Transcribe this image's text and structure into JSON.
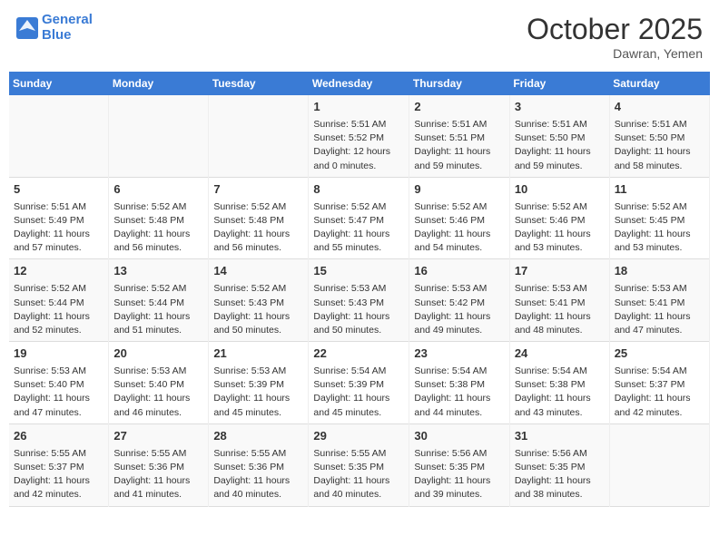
{
  "header": {
    "logo_line1": "General",
    "logo_line2": "Blue",
    "month": "October 2025",
    "location": "Dawran, Yemen"
  },
  "weekdays": [
    "Sunday",
    "Monday",
    "Tuesday",
    "Wednesday",
    "Thursday",
    "Friday",
    "Saturday"
  ],
  "weeks": [
    [
      {
        "day": "",
        "sunrise": "",
        "sunset": "",
        "daylight": ""
      },
      {
        "day": "",
        "sunrise": "",
        "sunset": "",
        "daylight": ""
      },
      {
        "day": "",
        "sunrise": "",
        "sunset": "",
        "daylight": ""
      },
      {
        "day": "1",
        "sunrise": "Sunrise: 5:51 AM",
        "sunset": "Sunset: 5:52 PM",
        "daylight": "Daylight: 12 hours and 0 minutes."
      },
      {
        "day": "2",
        "sunrise": "Sunrise: 5:51 AM",
        "sunset": "Sunset: 5:51 PM",
        "daylight": "Daylight: 11 hours and 59 minutes."
      },
      {
        "day": "3",
        "sunrise": "Sunrise: 5:51 AM",
        "sunset": "Sunset: 5:50 PM",
        "daylight": "Daylight: 11 hours and 59 minutes."
      },
      {
        "day": "4",
        "sunrise": "Sunrise: 5:51 AM",
        "sunset": "Sunset: 5:50 PM",
        "daylight": "Daylight: 11 hours and 58 minutes."
      }
    ],
    [
      {
        "day": "5",
        "sunrise": "Sunrise: 5:51 AM",
        "sunset": "Sunset: 5:49 PM",
        "daylight": "Daylight: 11 hours and 57 minutes."
      },
      {
        "day": "6",
        "sunrise": "Sunrise: 5:52 AM",
        "sunset": "Sunset: 5:48 PM",
        "daylight": "Daylight: 11 hours and 56 minutes."
      },
      {
        "day": "7",
        "sunrise": "Sunrise: 5:52 AM",
        "sunset": "Sunset: 5:48 PM",
        "daylight": "Daylight: 11 hours and 56 minutes."
      },
      {
        "day": "8",
        "sunrise": "Sunrise: 5:52 AM",
        "sunset": "Sunset: 5:47 PM",
        "daylight": "Daylight: 11 hours and 55 minutes."
      },
      {
        "day": "9",
        "sunrise": "Sunrise: 5:52 AM",
        "sunset": "Sunset: 5:46 PM",
        "daylight": "Daylight: 11 hours and 54 minutes."
      },
      {
        "day": "10",
        "sunrise": "Sunrise: 5:52 AM",
        "sunset": "Sunset: 5:46 PM",
        "daylight": "Daylight: 11 hours and 53 minutes."
      },
      {
        "day": "11",
        "sunrise": "Sunrise: 5:52 AM",
        "sunset": "Sunset: 5:45 PM",
        "daylight": "Daylight: 11 hours and 53 minutes."
      }
    ],
    [
      {
        "day": "12",
        "sunrise": "Sunrise: 5:52 AM",
        "sunset": "Sunset: 5:44 PM",
        "daylight": "Daylight: 11 hours and 52 minutes."
      },
      {
        "day": "13",
        "sunrise": "Sunrise: 5:52 AM",
        "sunset": "Sunset: 5:44 PM",
        "daylight": "Daylight: 11 hours and 51 minutes."
      },
      {
        "day": "14",
        "sunrise": "Sunrise: 5:52 AM",
        "sunset": "Sunset: 5:43 PM",
        "daylight": "Daylight: 11 hours and 50 minutes."
      },
      {
        "day": "15",
        "sunrise": "Sunrise: 5:53 AM",
        "sunset": "Sunset: 5:43 PM",
        "daylight": "Daylight: 11 hours and 50 minutes."
      },
      {
        "day": "16",
        "sunrise": "Sunrise: 5:53 AM",
        "sunset": "Sunset: 5:42 PM",
        "daylight": "Daylight: 11 hours and 49 minutes."
      },
      {
        "day": "17",
        "sunrise": "Sunrise: 5:53 AM",
        "sunset": "Sunset: 5:41 PM",
        "daylight": "Daylight: 11 hours and 48 minutes."
      },
      {
        "day": "18",
        "sunrise": "Sunrise: 5:53 AM",
        "sunset": "Sunset: 5:41 PM",
        "daylight": "Daylight: 11 hours and 47 minutes."
      }
    ],
    [
      {
        "day": "19",
        "sunrise": "Sunrise: 5:53 AM",
        "sunset": "Sunset: 5:40 PM",
        "daylight": "Daylight: 11 hours and 47 minutes."
      },
      {
        "day": "20",
        "sunrise": "Sunrise: 5:53 AM",
        "sunset": "Sunset: 5:40 PM",
        "daylight": "Daylight: 11 hours and 46 minutes."
      },
      {
        "day": "21",
        "sunrise": "Sunrise: 5:53 AM",
        "sunset": "Sunset: 5:39 PM",
        "daylight": "Daylight: 11 hours and 45 minutes."
      },
      {
        "day": "22",
        "sunrise": "Sunrise: 5:54 AM",
        "sunset": "Sunset: 5:39 PM",
        "daylight": "Daylight: 11 hours and 45 minutes."
      },
      {
        "day": "23",
        "sunrise": "Sunrise: 5:54 AM",
        "sunset": "Sunset: 5:38 PM",
        "daylight": "Daylight: 11 hours and 44 minutes."
      },
      {
        "day": "24",
        "sunrise": "Sunrise: 5:54 AM",
        "sunset": "Sunset: 5:38 PM",
        "daylight": "Daylight: 11 hours and 43 minutes."
      },
      {
        "day": "25",
        "sunrise": "Sunrise: 5:54 AM",
        "sunset": "Sunset: 5:37 PM",
        "daylight": "Daylight: 11 hours and 42 minutes."
      }
    ],
    [
      {
        "day": "26",
        "sunrise": "Sunrise: 5:55 AM",
        "sunset": "Sunset: 5:37 PM",
        "daylight": "Daylight: 11 hours and 42 minutes."
      },
      {
        "day": "27",
        "sunrise": "Sunrise: 5:55 AM",
        "sunset": "Sunset: 5:36 PM",
        "daylight": "Daylight: 11 hours and 41 minutes."
      },
      {
        "day": "28",
        "sunrise": "Sunrise: 5:55 AM",
        "sunset": "Sunset: 5:36 PM",
        "daylight": "Daylight: 11 hours and 40 minutes."
      },
      {
        "day": "29",
        "sunrise": "Sunrise: 5:55 AM",
        "sunset": "Sunset: 5:35 PM",
        "daylight": "Daylight: 11 hours and 40 minutes."
      },
      {
        "day": "30",
        "sunrise": "Sunrise: 5:56 AM",
        "sunset": "Sunset: 5:35 PM",
        "daylight": "Daylight: 11 hours and 39 minutes."
      },
      {
        "day": "31",
        "sunrise": "Sunrise: 5:56 AM",
        "sunset": "Sunset: 5:35 PM",
        "daylight": "Daylight: 11 hours and 38 minutes."
      },
      {
        "day": "",
        "sunrise": "",
        "sunset": "",
        "daylight": ""
      }
    ]
  ]
}
